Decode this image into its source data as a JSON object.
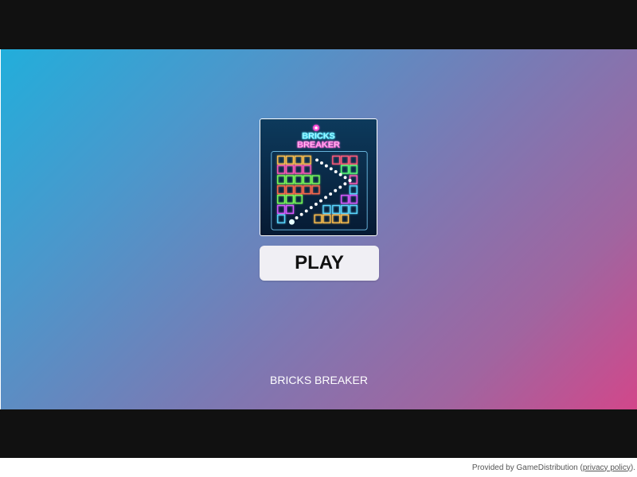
{
  "game": {
    "title": "BRICKS BREAKER",
    "thumbnail_title_line1": "BRICKS",
    "thumbnail_title_line2": "BREAKER",
    "play_label": "PLAY"
  },
  "footer": {
    "provided_by": "Provided by GameDistribution (",
    "privacy_link": "privacy policy",
    "suffix": ")."
  },
  "colors": {
    "gradient_start": "#22aedb",
    "gradient_end": "#d2478a",
    "letterbox": "#111111",
    "button_bg": "#f0eff4"
  }
}
